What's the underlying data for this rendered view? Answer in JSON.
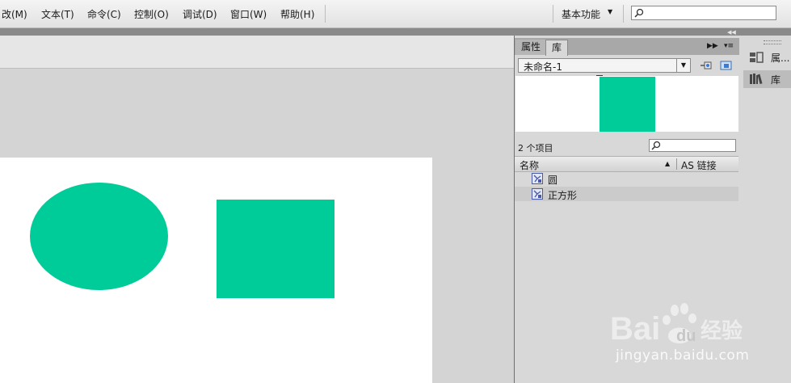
{
  "menu": {
    "items": [
      {
        "label": "改(M)"
      },
      {
        "label": "文本(T)"
      },
      {
        "label": "命令(C)"
      },
      {
        "label": "控制(O)"
      },
      {
        "label": "调试(D)"
      },
      {
        "label": "窗口(W)"
      },
      {
        "label": "帮助(H)"
      }
    ],
    "workspace": "基本功能",
    "search_value": ""
  },
  "library": {
    "tabs": [
      "属性",
      "库"
    ],
    "active_tab": "库",
    "document": "未命名-1",
    "item_count": "2 个项目",
    "search_value": "",
    "columns": {
      "name": "名称",
      "linkage": "AS 链接"
    },
    "items": [
      {
        "label": "圆"
      },
      {
        "label": "正方形"
      }
    ]
  },
  "side_dock": {
    "items": [
      {
        "label": "属..."
      },
      {
        "label": "库"
      }
    ]
  },
  "stage": {
    "shape_color": "#00cc99"
  },
  "watermark": {
    "url": "jingyan.baidu.com"
  }
}
